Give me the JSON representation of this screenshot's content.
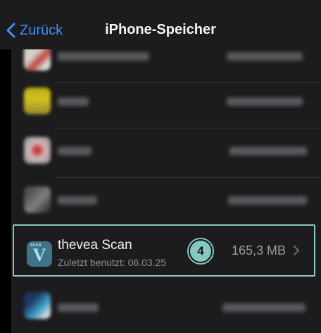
{
  "nav": {
    "back_label": "Zurück",
    "title": "iPhone-Speicher"
  },
  "highlighted_app": {
    "name": "thevea Scan",
    "subtitle": "Zuletzt benutzt: 06.03.25",
    "size": "165,3 MB",
    "step_number": "4",
    "icon_text": "V",
    "icon_tag": "SCAN"
  },
  "colors": {
    "accent": "#3d8ff5",
    "highlight": "#86c7bf",
    "list_bg": "#1c1c1e",
    "icon_bg": "#3f7388"
  },
  "blurred_rows_note_icons": [
    "blurred-app-icon-red",
    "blurred-app-icon-yellow",
    "blurred-app-icon-pink",
    "blurred-app-icon-gray",
    "blurred-app-icon-blue"
  ]
}
